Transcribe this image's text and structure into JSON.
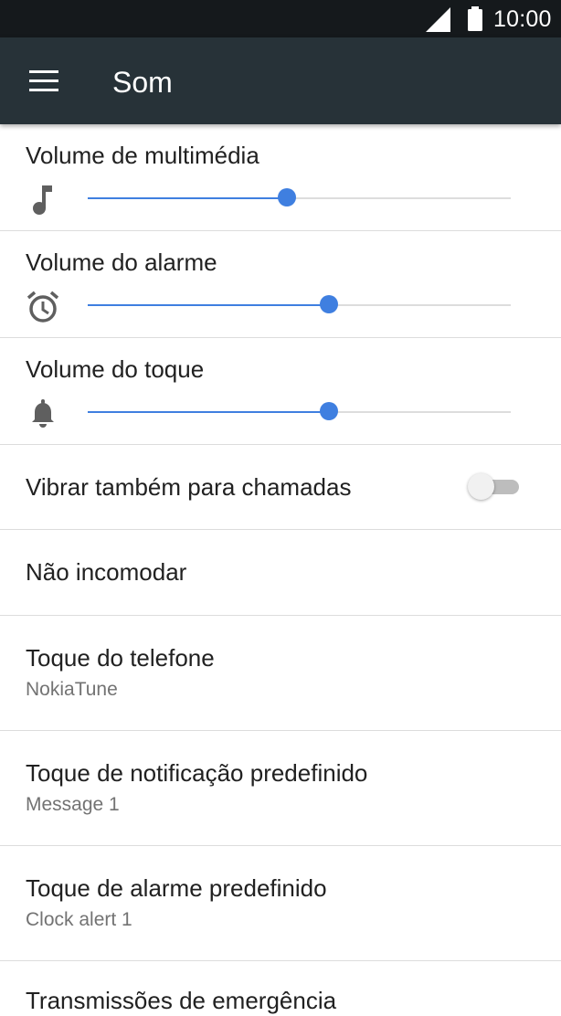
{
  "status_bar": {
    "time": "10:00",
    "icons": [
      "cell-signal-icon",
      "battery-icon"
    ]
  },
  "app_bar": {
    "title": "Som",
    "menu_icon": "hamburger-menu-icon"
  },
  "colors": {
    "app_bar_bg": "#273238",
    "status_bar_bg": "#15191c",
    "accent": "#3f7fe0",
    "divider": "#dcdcdc"
  },
  "volumes": [
    {
      "label": "Volume de multimédia",
      "icon": "music-note-icon",
      "level": 0.47
    },
    {
      "label": "Volume do alarme",
      "icon": "alarm-clock-icon",
      "level": 0.57
    },
    {
      "label": "Volume do toque",
      "icon": "bell-icon",
      "level": 0.57
    }
  ],
  "vibrate": {
    "label": "Vibrar também para chamadas",
    "enabled": false
  },
  "settings": [
    {
      "label": "Não incomodar"
    },
    {
      "label": "Toque do telefone",
      "value": "NokiaTune"
    },
    {
      "label": "Toque de notificação predefinido",
      "value": "Message 1"
    },
    {
      "label": "Toque de alarme predefinido",
      "value": "Clock alert 1"
    },
    {
      "label": "Transmissões de emergência"
    }
  ]
}
